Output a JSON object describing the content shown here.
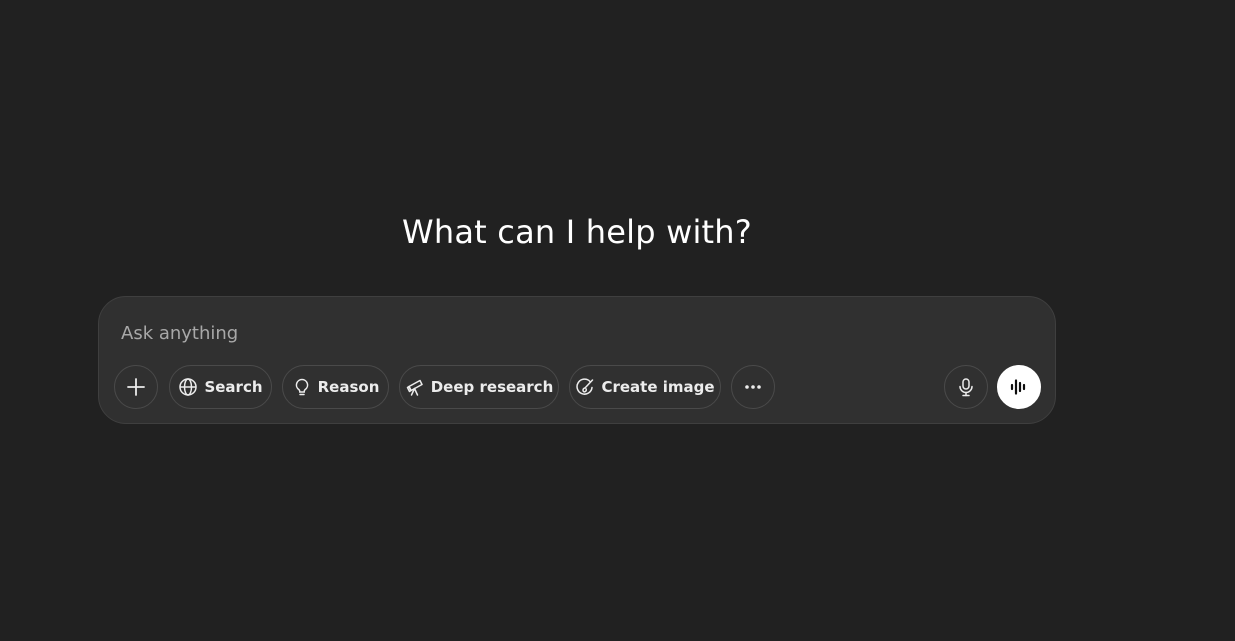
{
  "main": {
    "heading": "What can I help with?"
  },
  "composer": {
    "placeholder": "Ask anything",
    "tools": [
      {
        "label": "Search",
        "icon": "globe-icon"
      },
      {
        "label": "Reason",
        "icon": "lightbulb-icon"
      },
      {
        "label": "Deep research",
        "icon": "telescope-icon"
      },
      {
        "label": "Create image",
        "icon": "paintbrush-icon"
      }
    ],
    "icons": {
      "attach": "plus-icon",
      "more": "more-horizontal-icon",
      "dictate": "microphone-icon",
      "voice": "voice-waveform-icon"
    }
  },
  "colors": {
    "background": "#212121",
    "composer": "#303030",
    "text": "#ececec",
    "placeholder": "#a8a8a8",
    "voice_button": "#ffffff"
  }
}
